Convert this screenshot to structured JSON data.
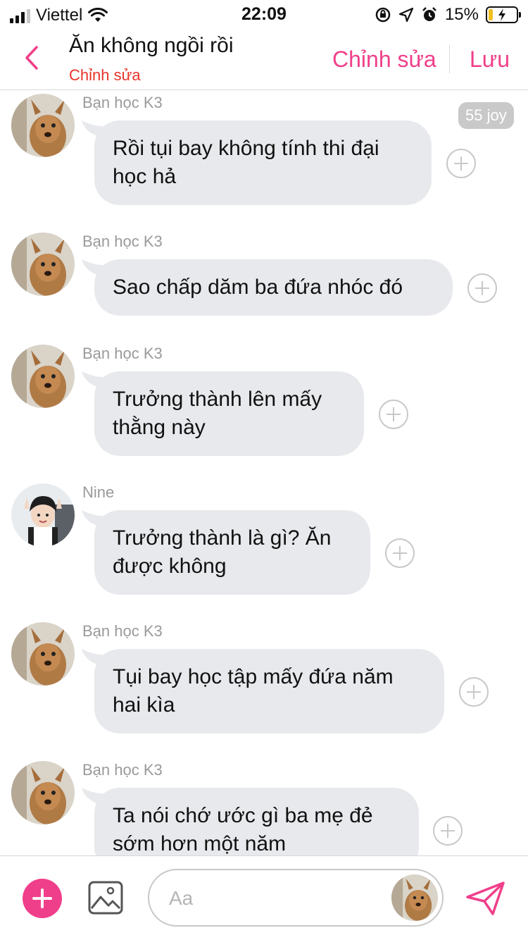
{
  "status_bar": {
    "carrier": "Viettel",
    "time": "22:09",
    "battery": "15%",
    "battery_level": 0.15
  },
  "header": {
    "title": "Ăn không ngồi rồi",
    "subtitle": "Chỉnh sửa",
    "edit_label": "Chỉnh sửa",
    "save_label": "Lưu"
  },
  "joy_badge": "55 joy",
  "messages": [
    {
      "sender": "Bạn học K3",
      "text_line1": "Rồi tụi bay không tính thi đại",
      "text_line2": "học hả"
    },
    {
      "sender": "Bạn học K3",
      "text_line1": "Sao chấp dăm ba đứa nhóc đó",
      "text_line2": ""
    },
    {
      "sender": "Bạn học K3",
      "text_line1": "Trưởng thành lên mấy",
      "text_line2": "thằng này"
    },
    {
      "sender": "Nine",
      "text_line1": "Trưởng thành là gì? Ăn",
      "text_line2": "được không"
    },
    {
      "sender": "Bạn học K3",
      "text_line1": "Tụi bay học tập mấy đứa năm",
      "text_line2": "hai kìa"
    },
    {
      "sender": "Bạn học K3",
      "text_line1": "Ta nói chớ ước gì ba mẹ đẻ",
      "text_line2": "sớm hơn một năm"
    }
  ],
  "composer": {
    "placeholder": "Aa"
  },
  "colors": {
    "accent": "#f03f8a",
    "subtitle": "#e8342a",
    "bubble": "#e7e9ec",
    "meta": "#9a9a9a"
  },
  "icons": {
    "back": "chevron-left-icon",
    "add": "plus-circle-icon",
    "image": "image-icon",
    "send": "send-icon",
    "react": "plus-outline-icon"
  }
}
